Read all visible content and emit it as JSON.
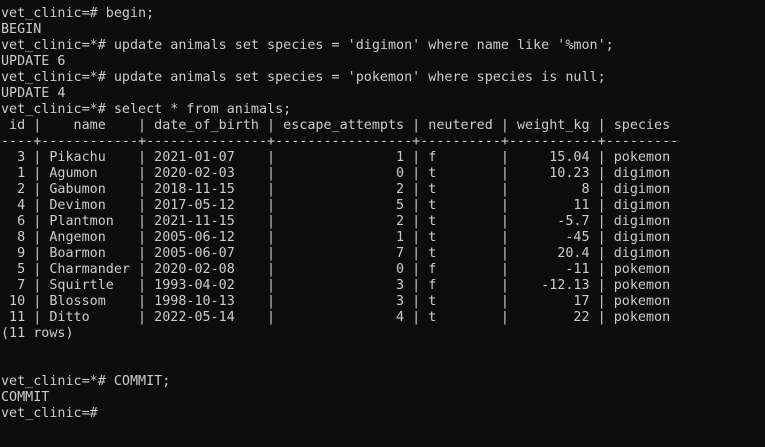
{
  "terminal": {
    "lines": [
      "vet_clinic=# begin;",
      "BEGIN",
      "vet_clinic=*# update animals set species = 'digimon' where name like '%mon';",
      "UPDATE 6",
      "vet_clinic=*# update animals set species = 'pokemon' where species is null;",
      "UPDATE 4",
      "vet_clinic=*# select * from animals;",
      " id |    name    | date_of_birth | escape_attempts | neutered | weight_kg | species",
      "----+------------+---------------+-----------------+----------+-----------+---------",
      "  3 | Pikachu    | 2021-01-07    |               1 | f        |     15.04 | pokemon",
      "  1 | Agumon     | 2020-02-03    |               0 | t        |     10.23 | digimon",
      "  2 | Gabumon    | 2018-11-15    |               2 | t        |         8 | digimon",
      "  4 | Devimon    | 2017-05-12    |               5 | t        |        11 | digimon",
      "  6 | Plantmon   | 2021-11-15    |               2 | t        |      -5.7 | digimon",
      "  8 | Angemon    | 2005-06-12    |               1 | t        |       -45 | digimon",
      "  9 | Boarmon    | 2005-06-07    |               7 | t        |      20.4 | digimon",
      "  5 | Charmander | 2020-02-08    |               0 | f        |       -11 | pokemon",
      "  7 | Squirtle   | 1993-04-02    |               3 | f        |    -12.13 | pokemon",
      " 10 | Blossom    | 1998-10-13    |               3 | t        |        17 | pokemon",
      " 11 | Ditto      | 2022-05-14    |               4 | t        |        22 | pokemon",
      "(11 rows)",
      "",
      "",
      "vet_clinic=*# COMMIT;",
      "COMMIT",
      "vet_clinic=#"
    ]
  }
}
